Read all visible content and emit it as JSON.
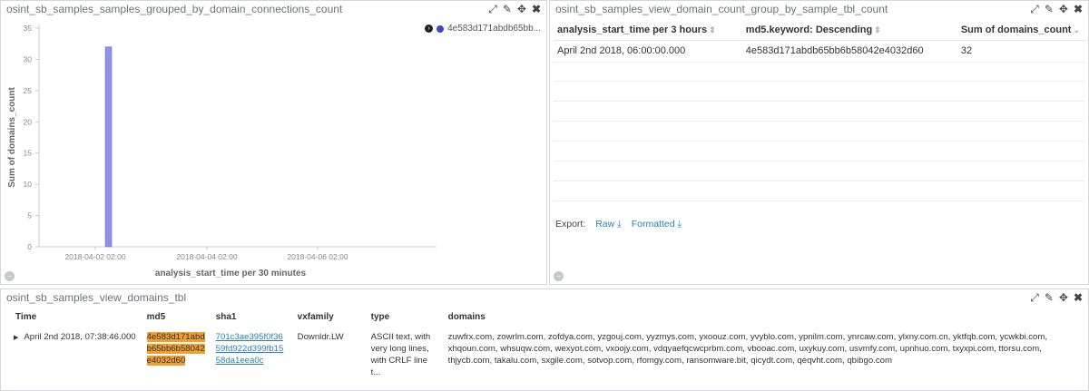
{
  "panels": {
    "chart": {
      "title": "osint_sb_samples_samples_grouped_by_domain_connections_count",
      "legend_label": "4e583d171abdb65bb...",
      "controls": [
        "⤢",
        "✎",
        "✥",
        "✖"
      ]
    },
    "count_table": {
      "title": "osint_sb_samples_view_domain_count_group_by_sample_tbl_count",
      "columns": [
        "analysis_start_time per 3 hours",
        "md5.keyword: Descending",
        "Sum of domains_count"
      ],
      "rows": [
        [
          "April 2nd 2018, 06:00:00.000",
          "4e583d171abdb65bb6b58042e4032d60",
          "32"
        ]
      ],
      "export_label": "Export:",
      "export_raw": "Raw",
      "export_formatted": "Formatted"
    },
    "domains_table": {
      "title": "osint_sb_samples_view_domains_tbl",
      "columns": [
        "Time",
        "md5",
        "sha1",
        "vxfamily",
        "type",
        "domains"
      ],
      "rows": [
        {
          "time": "April 2nd 2018, 07:38:46.000",
          "md5_lines": [
            "4e583d171abd",
            "b65bb6b58042",
            "e4032d60"
          ],
          "sha1_lines": [
            "701c3ae395f0f36",
            "59fd922d399fb15",
            "58da1eea0c"
          ],
          "vxfamily": "Downldr.LW",
          "type_lines": [
            "ASCII text, with",
            "very long lines,",
            "with CRLF line t..."
          ],
          "domains_lines": [
            "zuwfrx.com, zowrlm.com, zofdya.com, yzgouj.com, yyzmys.com, yxoouz.com, yvyblo.com, ypnilm.com, ynrcaw.com, ylxny.com.cn, yktfqb.com, ycwkbi.com,",
            "xhqoun.com, whsuqw.com, wexyot.com, vxoojy.com, vdqyaefqcwcprbm.com, vbooac.com, uxykuy.com, usvmfy.com, upnhuo.com, txyxpi.com, ttorsu.com,",
            "thjycb.com, takalu.com, sxgile.com, sotvop.com, rfomgy.com, ransomware.bit, qicydt.com, qeqvht.com, qbibgo.com"
          ]
        }
      ]
    }
  },
  "chart_data": {
    "type": "bar",
    "x": [
      "2018-04-02 02:00"
    ],
    "values": [
      32
    ],
    "xticks": [
      "2018-04-02 02:00",
      "2018-04-04 02:00",
      "2018-04-06 02:00"
    ],
    "yticks": [
      0,
      5,
      10,
      15,
      20,
      25,
      30,
      35
    ],
    "ylim": [
      0,
      35
    ],
    "xlabel": "analysis_start_time per 30 minutes",
    "ylabel": "Sum of domains_count",
    "legend_position": "top-right",
    "bar_color": "#8e92e4",
    "series_color": "#3f48c6"
  }
}
